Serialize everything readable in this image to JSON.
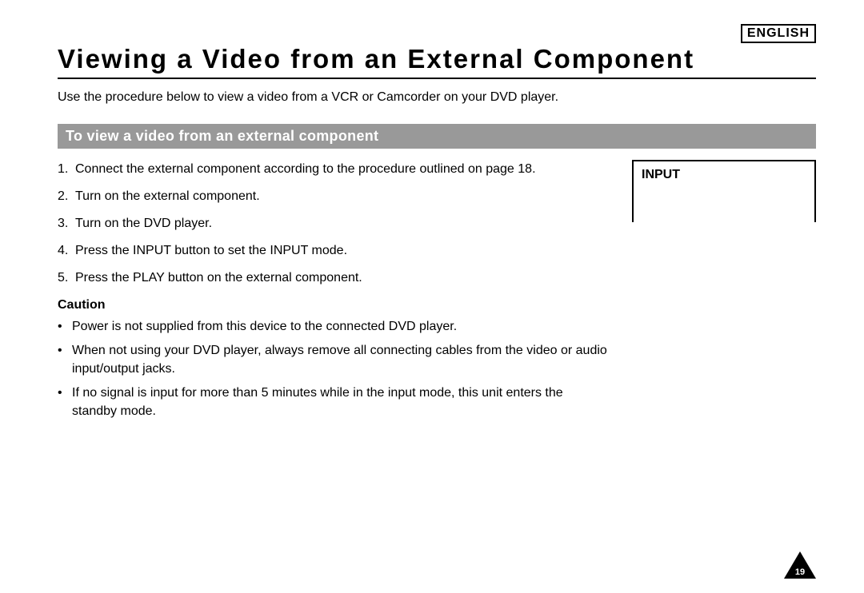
{
  "language_label": "ENGLISH",
  "title": "Viewing a Video from an External Component",
  "intro": "Use the procedure below to view a video from a VCR or Camcorder on your DVD player.",
  "section_heading": "To view a video from an external component",
  "steps": [
    {
      "n": "1.",
      "text": "Connect the external component according to the procedure outlined on page 18."
    },
    {
      "n": "2.",
      "text": "Turn on the external component."
    },
    {
      "n": "3.",
      "text": "Turn on the DVD player."
    },
    {
      "n": "4.",
      "text": "Press the INPUT button to set the INPUT mode."
    },
    {
      "n": "5.",
      "text": "Press the PLAY button on the external component."
    }
  ],
  "caution_heading": "Caution",
  "cautions": [
    "Power is not supplied from this device to the connected DVD player.",
    "When not using your DVD player, always remove all connecting cables from the video or audio input/output jacks.",
    "If no signal is input for more than 5 minutes while in the input mode, this unit enters the standby mode."
  ],
  "callout_label": "INPUT",
  "page_number": "19"
}
